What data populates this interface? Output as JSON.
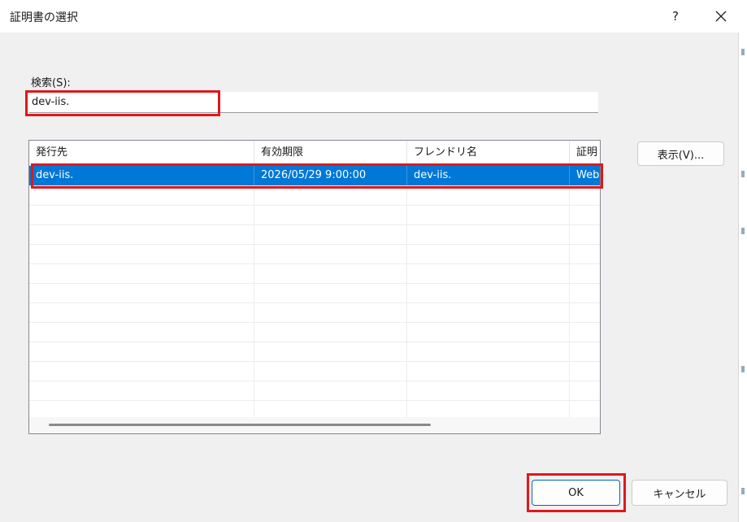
{
  "dialog": {
    "title": "証明書の選択",
    "help_label": "?"
  },
  "search": {
    "label": "検索(S):",
    "value": "dev-iis."
  },
  "table": {
    "columns": [
      "発行先",
      "有効期限",
      "フレンドリ名",
      "証明"
    ],
    "rows": [
      {
        "issued_to": "dev-iis.",
        "expires": "2026/05/29 9:00:00",
        "friendly_name": "dev-iis.",
        "purpose": "Web",
        "selected": true
      }
    ]
  },
  "buttons": {
    "view": "表示(V)...",
    "ok": "OK",
    "cancel": "キャンセル"
  },
  "colors": {
    "selection": "#0078d7",
    "highlight_box": "#e0181b",
    "background": "#f0f0f0"
  }
}
